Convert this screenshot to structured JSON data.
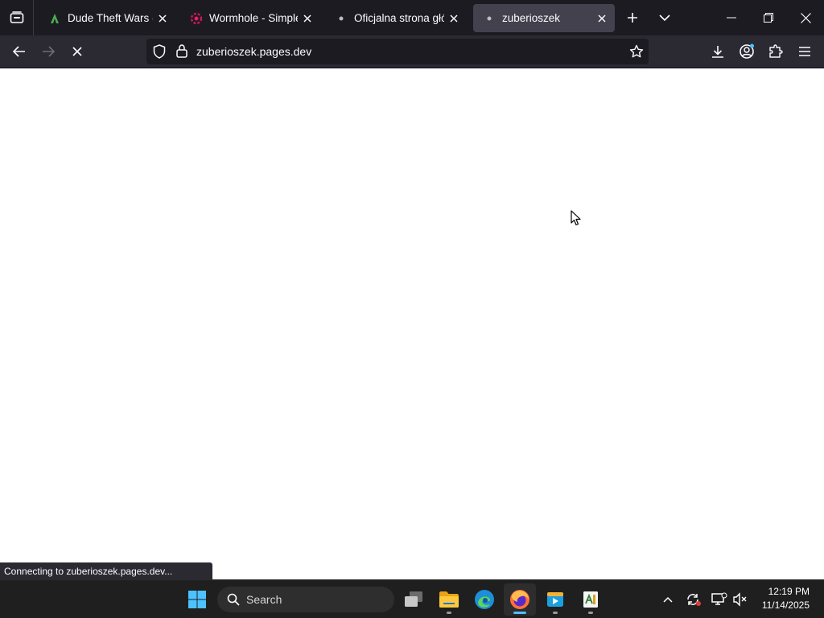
{
  "tabs": [
    {
      "title": "Dude Theft Wars (MOD",
      "favicon": "green-leaf-icon"
    },
    {
      "title": "Wormhole - Simple, pri",
      "favicon": "wormhole-icon"
    },
    {
      "title": "Oficjalna strona główna",
      "favicon": "dot-icon"
    },
    {
      "title": "zuberioszek",
      "favicon": "dot-icon",
      "active": true
    }
  ],
  "urlbar": {
    "url": "zuberioszek.pages.dev"
  },
  "status": {
    "text": "Connecting to zuberioszek.pages.dev..."
  },
  "taskbar": {
    "search_label": "Search",
    "apps": [
      "task-view",
      "file-explorer",
      "edge",
      "firefox",
      "media-player",
      "documents"
    ],
    "active_app": "firefox"
  },
  "clock": {
    "time": "12:19 PM",
    "date": "11/14/2025"
  },
  "colors": {
    "tabbar": "#1c1b22",
    "navbar": "#2b2a33",
    "active_tab": "#42414d",
    "taskbar": "#1f1f1f",
    "accent": "#4cc2ff"
  }
}
